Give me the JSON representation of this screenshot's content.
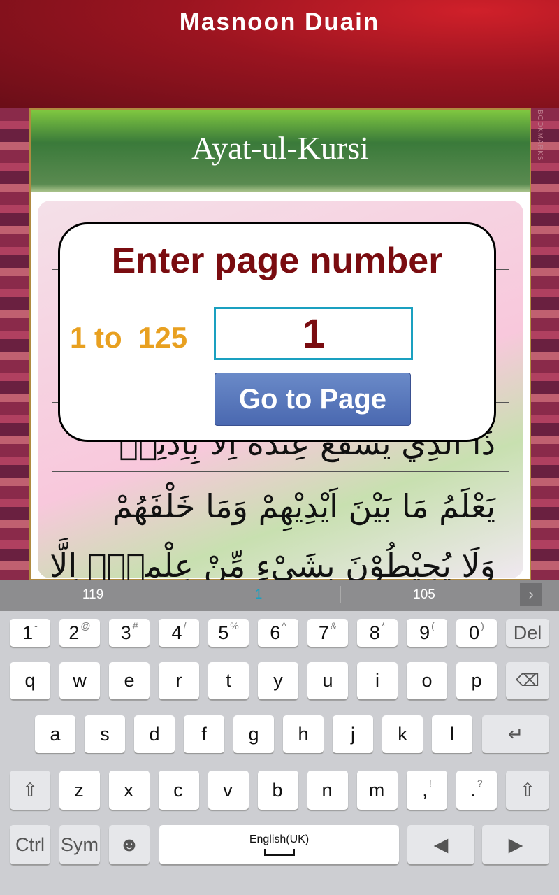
{
  "app": {
    "title": "Masnoon Duain"
  },
  "book": {
    "chapter_title": "Ayat-ul-Kursi",
    "bookmarks_label": "BOOKMARKS",
    "arabic_lines": [
      "ذَا الَّذِيْ يَشْفَعُ عِنْدَهٗٓ اِلَّا بِاِذْنِهٖ",
      "يَعْلَمُ مَا بَيْنَ اَيْدِيْهِمْ وَمَا خَلْفَهُمْ",
      "وَلَا يُحِيْطُوْنَ بِشَيْءٍ مِّنْ عِلْمِهٖٓ اِلَّا بِمَا"
    ]
  },
  "dialog": {
    "title": "Enter page number",
    "range": "1 to  125",
    "input_value": "1",
    "go_label": "Go to Page"
  },
  "keyboard": {
    "suggestions": [
      "119",
      "1",
      "105"
    ],
    "accent_color": "#1aa0c0",
    "row1": [
      [
        "1",
        "-"
      ],
      [
        "2",
        "@"
      ],
      [
        "3",
        "#"
      ],
      [
        "4",
        "/"
      ],
      [
        "5",
        "%"
      ],
      [
        "6",
        "^"
      ],
      [
        "7",
        "&"
      ],
      [
        "8",
        "*"
      ],
      [
        "9",
        "("
      ],
      [
        "0",
        ")"
      ]
    ],
    "del": "Del",
    "row2": [
      "q",
      "w",
      "e",
      "r",
      "t",
      "y",
      "u",
      "i",
      "o",
      "p"
    ],
    "row3": [
      "a",
      "s",
      "d",
      "f",
      "g",
      "h",
      "j",
      "k",
      "l"
    ],
    "row4": [
      [
        "z",
        ""
      ],
      [
        "x",
        ""
      ],
      [
        "c",
        ""
      ],
      [
        "v",
        ""
      ],
      [
        "b",
        ""
      ],
      [
        "n",
        ""
      ],
      [
        "m",
        ""
      ],
      [
        ",",
        "!"
      ],
      [
        ".",
        "?"
      ]
    ],
    "ctrl": "Ctrl",
    "sym": "Sym",
    "space_label": "English(UK)"
  }
}
